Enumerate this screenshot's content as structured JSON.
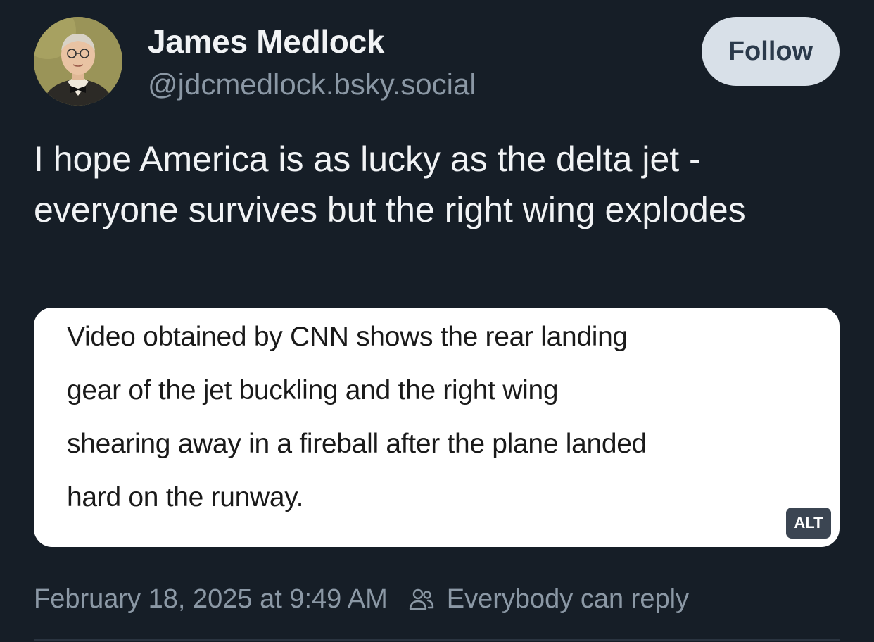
{
  "author": {
    "display_name": "James Medlock",
    "handle": "@jdcmedlock.bsky.social",
    "avatar_icon": "portrait-avatar"
  },
  "actions": {
    "follow_label": "Follow"
  },
  "post": {
    "text": "I hope America is as lucky as the delta jet - everyone survives but the right wing explodes",
    "embed": {
      "lines": [
        "Video obtained by CNN shows the rear landing",
        "gear of the jet buckling and the right wing",
        "shearing away in a fireball after the plane landed",
        "hard on the runway."
      ],
      "alt_badge": "ALT"
    }
  },
  "meta": {
    "timestamp": "February 18, 2025 at 9:49 AM",
    "reply_setting": "Everybody can reply",
    "reply_icon": "people-icon"
  },
  "colors": {
    "background": "#161e27",
    "follow_button": "#d8e0e8",
    "muted_text": "#8b98a5"
  }
}
